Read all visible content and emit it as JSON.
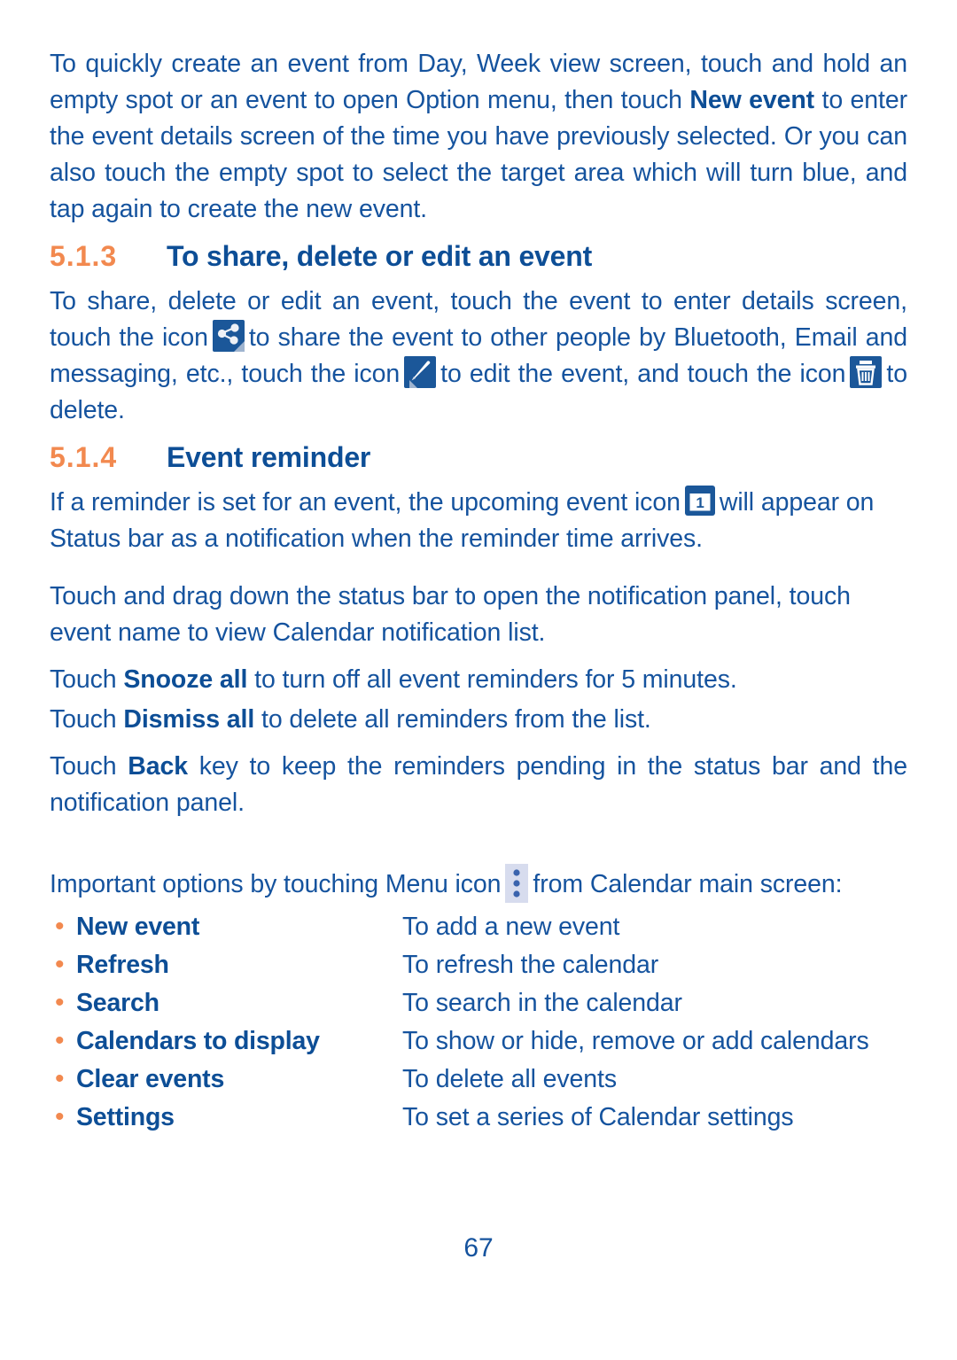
{
  "page": {
    "number": "67",
    "text_color": "#15539e",
    "heading_color": "#0d4e96",
    "accent_color": "#f2894f",
    "icon_bg_color": "#1b5799",
    "menu_icon_bg_color": "#d7dcee"
  },
  "intro": {
    "p1_part1": "To quickly create an event from Day, Week view screen, touch and hold an empty spot or an event to open Option menu, then touch ",
    "p1_bold": "New event",
    "p1_part2": " to enter the event details screen of the time you have previously selected. Or you can also touch the empty spot to select the target area which will turn blue, and tap again to create the new event."
  },
  "section_513": {
    "number": "5.1.3",
    "title": "To share, delete or edit an event",
    "body_part1": "To share, delete or edit an event, touch the event to enter details screen, touch the icon",
    "share_icon": "share-icon",
    "body_part2": "to share the event to other people by Bluetooth, Email and messaging, etc., touch the icon",
    "edit_icon": "edit-pencil-icon",
    "body_part3": "to edit the event, and touch the icon",
    "delete_icon": "trash-delete-icon",
    "body_part4": "to delete."
  },
  "section_514": {
    "number": "5.1.4",
    "title": "Event reminder",
    "p1_part1": "If a reminder is set for an event, the upcoming event icon",
    "calendar_icon": "calendar-1-icon",
    "calendar_icon_label": "1",
    "p1_part2": "will appear on Status bar as a notification when the reminder time arrives.",
    "p2": "Touch and drag down the status bar to open the notification panel, touch event name to view Calendar notification list.",
    "p3_prefix": "Touch ",
    "p3_bold": "Snooze all",
    "p3_suffix": " to turn off all event reminders for 5 minutes.",
    "p4_prefix": "Touch ",
    "p4_bold": "Dismiss all",
    "p4_suffix": " to delete all reminders from the list.",
    "p5_prefix": "Touch ",
    "p5_bold": "Back",
    "p5_suffix": " key to keep the reminders pending in the status bar and the notification panel.",
    "p6_part1": "Important options by touching Menu icon",
    "menu_icon": "menu-three-dots-icon",
    "p6_part2": "from Calendar main screen:"
  },
  "options": [
    {
      "bullet": "•",
      "label": "New event",
      "desc": "To add a new event"
    },
    {
      "bullet": "•",
      "label": "Refresh",
      "desc": "To refresh the calendar"
    },
    {
      "bullet": "•",
      "label": "Search",
      "desc": "To search in the calendar"
    },
    {
      "bullet": "•",
      "label": "Calendars to display",
      "desc": "To show or hide, remove or add calendars"
    },
    {
      "bullet": "•",
      "label": "Clear events",
      "desc": "To delete all events"
    },
    {
      "bullet": "•",
      "label": "Settings",
      "desc": "To set a series of Calendar settings"
    }
  ]
}
